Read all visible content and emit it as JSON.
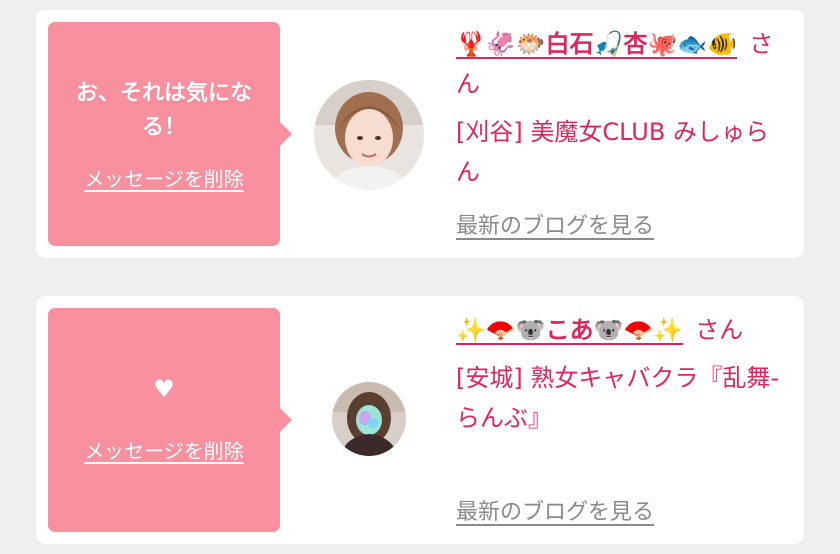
{
  "cards": [
    {
      "bubble_text": "お、それは気になる！",
      "delete_label": "メッセージを削除",
      "cast_name": "🦞🦑🐡白石🎣杏🐙🐟🐠",
      "honorific": "さん",
      "shop": "[刈谷] 美魔女CLUB みしゅらん",
      "blog_label": "最新のブログを見る"
    },
    {
      "bubble_text": "♥",
      "delete_label": "メッセージを削除",
      "cast_name": "✨🪭🐨こあ🐨🪭✨",
      "honorific": "さん",
      "shop": "[安城] 熟女キャバクラ『乱舞-らんぶ』",
      "blog_label": "最新のブログを見る"
    }
  ],
  "colors": {
    "bubble": "#f8909f",
    "accent": "#e0245e",
    "link_gray": "#8a8a8a"
  }
}
